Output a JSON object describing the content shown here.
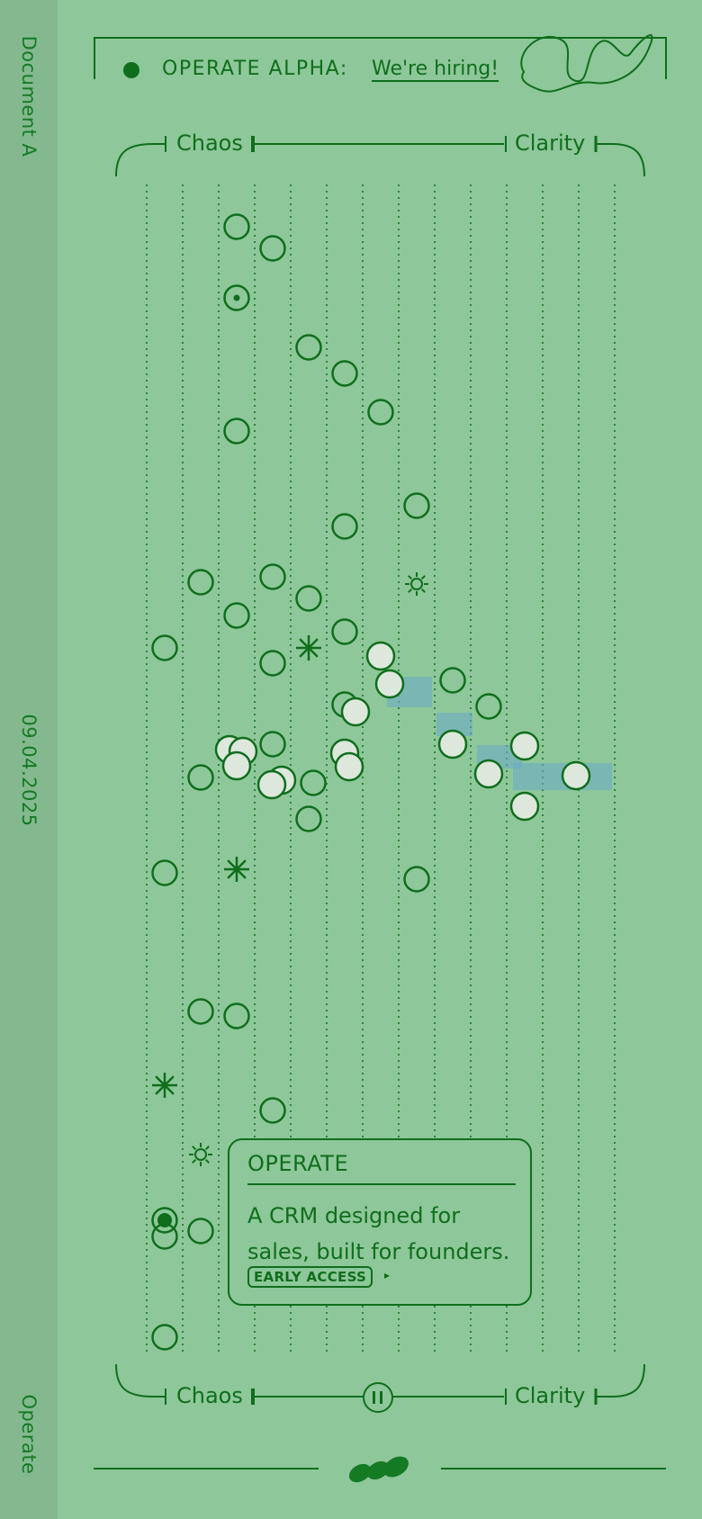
{
  "sidebar": {
    "top_label": "Document A",
    "middle_label": "09.04.2025",
    "bottom_label": "Operate"
  },
  "header": {
    "announcement": "OPERATE ALPHA:",
    "link_label": "We're hiring!"
  },
  "scale_top": {
    "left_label": "Chaos",
    "right_label": "Clarity"
  },
  "scale_bottom": {
    "left_label": "Chaos",
    "right_label": "Clarity"
  },
  "card": {
    "title": "OPERATE",
    "description": "A CRM designed for sales, built for founders.",
    "cta_label": "EARLY ACCESS"
  },
  "colors": {
    "background": "#8ec79a",
    "sidebar": "#84b98f",
    "ink": "#0f6e1c",
    "highlight_blue": "#6aa8c8",
    "bubble_fill": "#dde7dc"
  },
  "icons": [
    "logo-squiggle-icon",
    "sun-icon",
    "asterisk-icon",
    "pause-icon",
    "chevron-right-icon"
  ]
}
